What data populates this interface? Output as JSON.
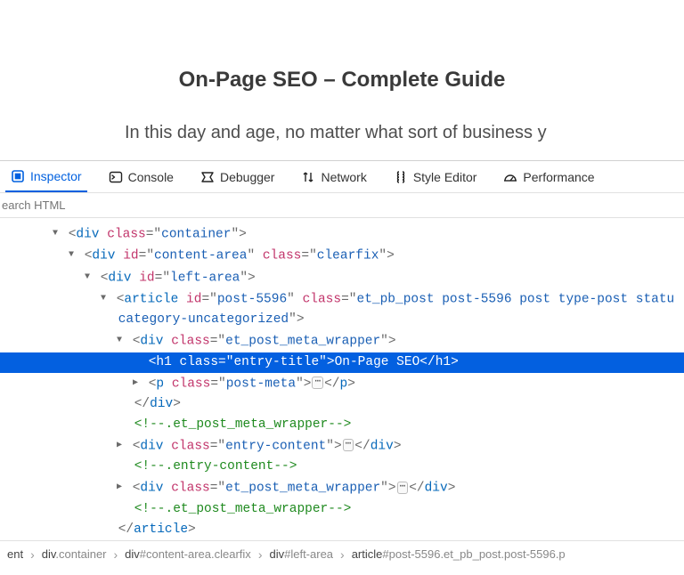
{
  "page": {
    "title": "On-Page SEO – Complete Guide",
    "para": "In this day and age, no matter what sort of business y"
  },
  "devtools": {
    "tabs": {
      "inspector": "Inspector",
      "console": "Console",
      "debugger": "Debugger",
      "network": "Network",
      "styleeditor": "Style Editor",
      "performance": "Performance"
    },
    "search_placeholder": "earch HTML"
  },
  "dom": {
    "r1": {
      "tag": "div",
      "a1n": "class",
      "a1v": "container"
    },
    "r2": {
      "tag": "div",
      "a1n": "id",
      "a1v": "content-area",
      "a2n": "class",
      "a2v": "clearfix"
    },
    "r3": {
      "tag": "div",
      "a1n": "id",
      "a1v": "left-area"
    },
    "r4": {
      "tag": "article",
      "a1n": "id",
      "a1v": "post-5596",
      "a2n": "class",
      "a2v": "et_pb_post post-5596 post type-post statu",
      "cont": "category-uncategorized"
    },
    "r5": {
      "tag": "div",
      "a1n": "class",
      "a1v": "et_post_meta_wrapper"
    },
    "r6": {
      "tag": "h1",
      "a1n": "class",
      "a1v": "entry-title",
      "text": "On-Page SEO",
      "closetag": "h1"
    },
    "r7": {
      "tag": "p",
      "a1n": "class",
      "a1v": "post-meta",
      "closetag": "p"
    },
    "r8": {
      "closetag": "div"
    },
    "r9": {
      "comment": ".et_post_meta_wrapper"
    },
    "r10": {
      "tag": "div",
      "a1n": "class",
      "a1v": "entry-content",
      "closetag": "div"
    },
    "r11": {
      "comment": ".entry-content"
    },
    "r12": {
      "tag": "div",
      "a1n": "class",
      "a1v": "et_post_meta_wrapper",
      "closetag": "div"
    },
    "r13": {
      "comment": ".et_post_meta_wrapper"
    },
    "r14": {
      "closetag": "article"
    }
  },
  "breadcrumbs": {
    "c1": {
      "tag": "ent"
    },
    "c2": {
      "tag": "div",
      "sel": ".container"
    },
    "c3": {
      "tag": "div",
      "sel": "#content-area.clearfix"
    },
    "c4": {
      "tag": "div",
      "sel": "#left-area"
    },
    "c5": {
      "tag": "article",
      "sel": "#post-5596.et_pb_post.post-5596.p"
    }
  },
  "glyphs": {
    "ellipsis": "⋯",
    "chevron": "›"
  }
}
